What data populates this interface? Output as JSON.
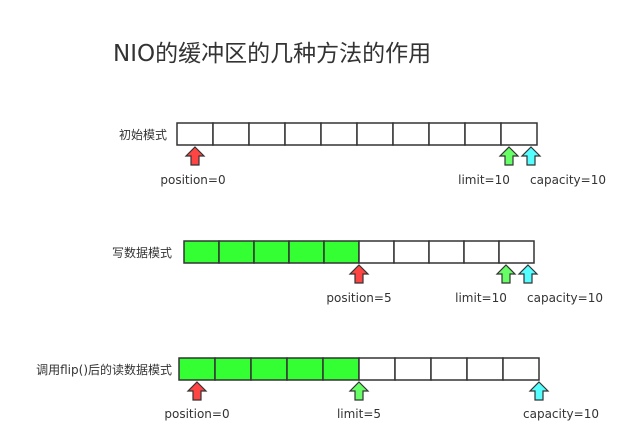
{
  "title": "NIO的缓冲区的几种方法的作用",
  "colors": {
    "filled": "#33ff33",
    "empty": "#ffffff",
    "border": "#333333",
    "position_arrow": "#ff4444",
    "limit_arrow": "#66ff66",
    "capacity_arrow": "#55ffff"
  },
  "rows": [
    {
      "label": "初始模式",
      "cells": 10,
      "filled": 0,
      "markers": [
        {
          "kind": "position",
          "label": "position=0",
          "index": 0
        },
        {
          "kind": "limit",
          "label": "limit=10",
          "index": 10
        },
        {
          "kind": "capacity",
          "label": "capacity=10",
          "index": 10
        }
      ]
    },
    {
      "label": "写数据模式",
      "cells": 10,
      "filled": 5,
      "markers": [
        {
          "kind": "position",
          "label": "position=5",
          "index": 5
        },
        {
          "kind": "limit",
          "label": "limit=10",
          "index": 10
        },
        {
          "kind": "capacity",
          "label": "capacity=10",
          "index": 10
        }
      ]
    },
    {
      "label": "调用flip()后的读数据模式",
      "cells": 10,
      "filled": 5,
      "markers": [
        {
          "kind": "position",
          "label": "position=0",
          "index": 0
        },
        {
          "kind": "limit",
          "label": "limit=5",
          "index": 5
        },
        {
          "kind": "capacity",
          "label": "capacity=10",
          "index": 10
        }
      ]
    }
  ]
}
